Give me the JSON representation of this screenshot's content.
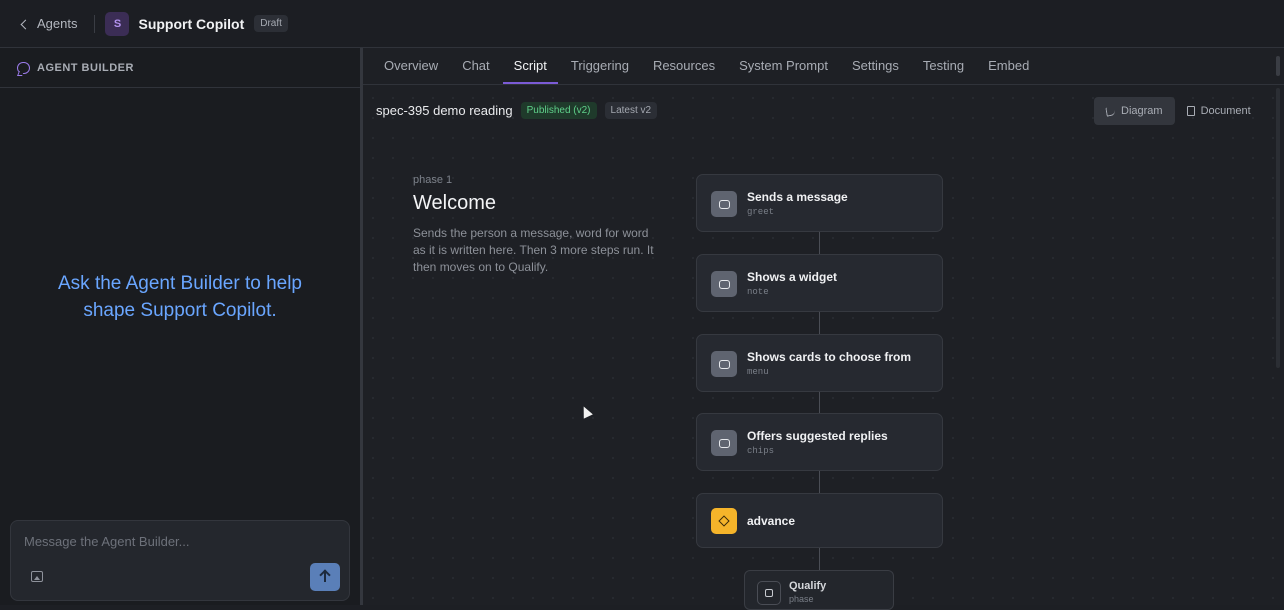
{
  "topbar": {
    "back_label": "Agents",
    "avatar_letter": "S",
    "title": "Support Copilot",
    "status_badge": "Draft"
  },
  "sidebar": {
    "header_label": "AGENT BUILDER",
    "prompt_line1": "Ask the Agent Builder to help",
    "prompt_line2": "shape Support Copilot.",
    "composer_placeholder": "Message the Agent Builder..."
  },
  "tabs": [
    {
      "label": "Overview",
      "active": false
    },
    {
      "label": "Chat",
      "active": false
    },
    {
      "label": "Script",
      "active": true
    },
    {
      "label": "Triggering",
      "active": false
    },
    {
      "label": "Resources",
      "active": false
    },
    {
      "label": "System Prompt",
      "active": false
    },
    {
      "label": "Settings",
      "active": false
    },
    {
      "label": "Testing",
      "active": false
    },
    {
      "label": "Embed",
      "active": false
    }
  ],
  "script": {
    "name": "spec-395 demo reading",
    "published_badge": "Published (v2)",
    "latest_badge": "Latest v2",
    "view_diagram": "Diagram",
    "view_document": "Document"
  },
  "phase": {
    "label": "phase 1",
    "title": "Welcome",
    "description": "Sends the person a message, word for word as it is written here. Then 3 more steps run. It then moves on to Qualify."
  },
  "steps": [
    {
      "title": "Sends a message",
      "sub": "greet"
    },
    {
      "title": "Shows a widget",
      "sub": "note"
    },
    {
      "title": "Shows cards to choose from",
      "sub": "menu"
    },
    {
      "title": "Offers suggested replies",
      "sub": "chips"
    },
    {
      "title": "advance",
      "sub": ""
    }
  ],
  "next_phase": {
    "title": "Qualify",
    "sub": "phase"
  },
  "colors": {
    "accent": "#7b5bd6",
    "prompt_text": "#6aa6ff",
    "published": "#5fd08a",
    "advance_icon": "#f5b42a"
  }
}
